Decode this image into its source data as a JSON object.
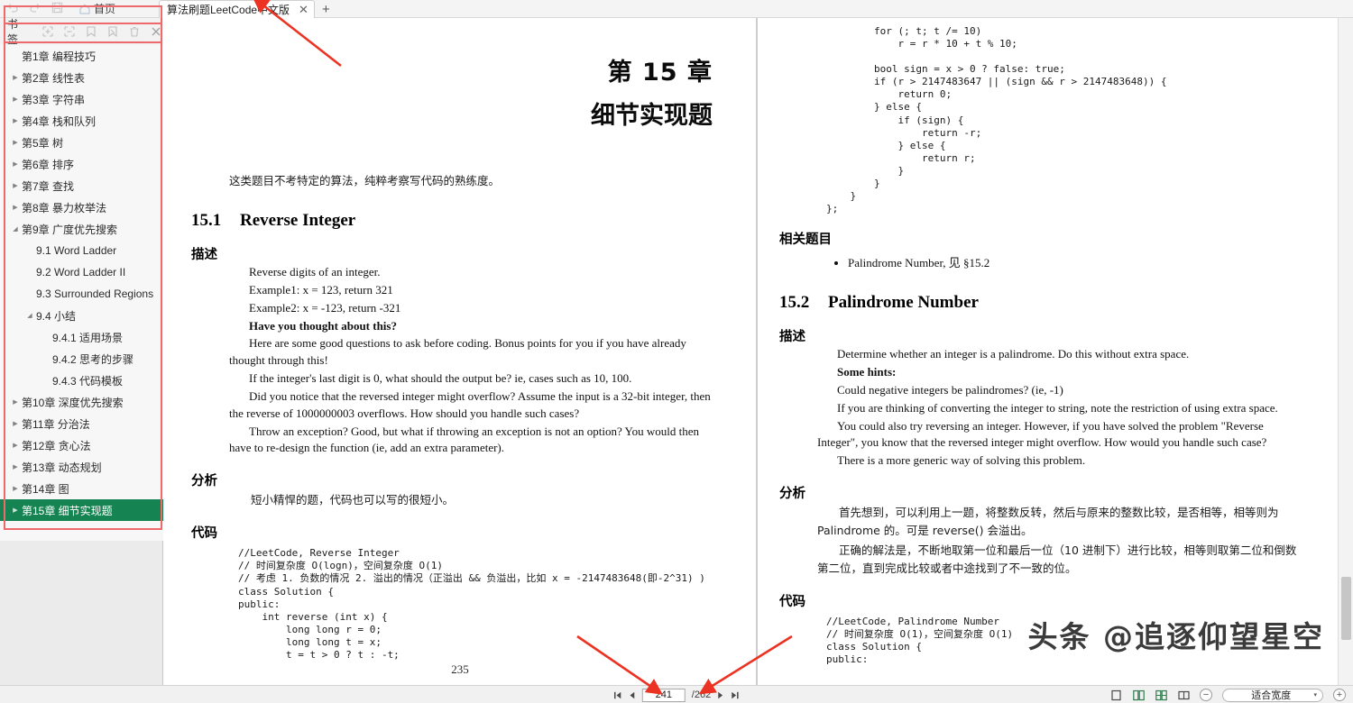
{
  "window": {
    "quick_access": [
      "undo-icon",
      "redo-icon",
      "save-icon"
    ],
    "home_label": "首页",
    "tab_title": "算法刷题LeetCode中文版",
    "tab_close": "✕",
    "new_tab": "+"
  },
  "sidebar": {
    "bookmarks_label": "书签",
    "tool_icons": [
      "expand-all-icon",
      "collapse-all-icon",
      "add-bookmark-icon",
      "edit-bookmark-icon",
      "delete-bookmark-icon",
      "close-panel-icon"
    ],
    "tree": [
      {
        "label": "第1章  编程技巧",
        "level": 0,
        "arrow": "",
        "selected": false
      },
      {
        "label": "第2章  线性表",
        "level": 0,
        "arrow": "▶",
        "selected": false
      },
      {
        "label": "第3章  字符串",
        "level": 0,
        "arrow": "▶",
        "selected": false
      },
      {
        "label": "第4章  栈和队列",
        "level": 0,
        "arrow": "▶",
        "selected": false
      },
      {
        "label": "第5章  树",
        "level": 0,
        "arrow": "▶",
        "selected": false
      },
      {
        "label": "第6章  排序",
        "level": 0,
        "arrow": "▶",
        "selected": false
      },
      {
        "label": "第7章  查找",
        "level": 0,
        "arrow": "▶",
        "selected": false
      },
      {
        "label": "第8章  暴力枚举法",
        "level": 0,
        "arrow": "▶",
        "selected": false
      },
      {
        "label": "第9章  广度优先搜索",
        "level": 0,
        "arrow": "◢",
        "selected": false
      },
      {
        "label": "9.1 Word Ladder",
        "level": 1,
        "arrow": "",
        "selected": false
      },
      {
        "label": "9.2 Word Ladder II",
        "level": 1,
        "arrow": "",
        "selected": false
      },
      {
        "label": "9.3 Surrounded Regions",
        "level": 1,
        "arrow": "",
        "selected": false
      },
      {
        "label": "9.4 小结",
        "level": 1,
        "arrow": "◢",
        "selected": false
      },
      {
        "label": "9.4.1 适用场景",
        "level": 2,
        "arrow": "",
        "selected": false
      },
      {
        "label": "9.4.2 思考的步骤",
        "level": 2,
        "arrow": "",
        "selected": false
      },
      {
        "label": "9.4.3 代码模板",
        "level": 2,
        "arrow": "",
        "selected": false
      },
      {
        "label": "第10章  深度优先搜索",
        "level": 0,
        "arrow": "▶",
        "selected": false
      },
      {
        "label": "第11章  分治法",
        "level": 0,
        "arrow": "▶",
        "selected": false
      },
      {
        "label": "第12章  贪心法",
        "level": 0,
        "arrow": "▶",
        "selected": false
      },
      {
        "label": "第13章  动态规划",
        "level": 0,
        "arrow": "▶",
        "selected": false
      },
      {
        "label": "第14章  图",
        "level": 0,
        "arrow": "▶",
        "selected": false
      },
      {
        "label": "第15章  细节实现题",
        "level": 0,
        "arrow": "▶",
        "selected": true
      }
    ]
  },
  "left_page": {
    "chapter_line1": "第 15 章",
    "chapter_line2": "细节实现题",
    "lead": "这类题目不考特定的算法，纯粹考察写代码的熟练度。",
    "section_num": "15.1",
    "section_title": "Reverse Integer",
    "desc_heading": "描述",
    "desc_lines": [
      "Reverse digits of an integer.",
      "Example1: x = 123, return 321",
      "Example2: x = -123, return -321"
    ],
    "desc_bold": "Have you thought about this?",
    "desc_paras": [
      "Here are some good questions to ask before coding. Bonus points for you if you have already thought through this!",
      "If the integer's last digit is 0, what should the output be? ie, cases such as 10, 100.",
      "Did you notice that the reversed integer might overflow? Assume the input is a 32-bit integer, then the reverse of 1000000003 overflows. How should you handle such cases?",
      "Throw an exception? Good, but what if throwing an exception is not an option? You would then have to re-design the function (ie, add an extra parameter)."
    ],
    "analysis_heading": "分析",
    "analysis_text": "短小精悍的题，代码也可以写的很短小。",
    "code_heading": "代码",
    "code": "//LeetCode, Reverse Integer\n// 时间复杂度 O(logn)，空间复杂度 O(1)\n// 考虑 1. 负数的情况 2. 溢出的情况（正溢出 && 负溢出，比如 x = -2147483648(即-2^31) )\nclass Solution {\npublic:\n    int reverse (int x) {\n        long long r = 0;\n        long long t = x;\n        t = t > 0 ? t : -t;",
    "page_number": "235"
  },
  "right_page": {
    "code_top": "        for (; t; t /= 10)\n            r = r * 10 + t % 10;\n\n        bool sign = x > 0 ? false: true;\n        if (r > 2147483647 || (sign && r > 2147483648)) {\n            return 0;\n        } else {\n            if (sign) {\n                return -r;\n            } else {\n                return r;\n            }\n        }\n    }\n};",
    "related_heading": "相关题目",
    "related_items": [
      "Palindrome Number, 见 §15.2"
    ],
    "section_num": "15.2",
    "section_title": "Palindrome Number",
    "desc_heading": "描述",
    "desc_line1": "Determine whether an integer is a palindrome. Do this without extra space.",
    "desc_bold": "Some hints:",
    "desc_paras": [
      "Could negative integers be palindromes? (ie, -1)",
      "If you are thinking of converting the integer to string, note the restriction of using extra space.",
      "You could also try reversing an integer. However, if you have solved the problem \"Reverse Integer\", you know that the reversed integer might overflow. How would you handle such case?",
      "There is a more generic way of solving this problem."
    ],
    "analysis_heading": "分析",
    "analysis_paras": [
      "首先想到，可以利用上一题，将整数反转，然后与原来的整数比较，是否相等，相等则为 Palindrome 的。可是 reverse() 会溢出。",
      "正确的解法是，不断地取第一位和最后一位（10 进制下）进行比较，相等则取第二位和倒数第二位，直到完成比较或者中途找到了不一致的位。"
    ],
    "code_heading": "代码",
    "code": "//LeetCode, Palindrome Number\n// 时间复杂度 O(1)，空间复杂度 O(1)\nclass Solution {\npublic:"
  },
  "watermark": "头条 @追逐仰望星空",
  "bottom_bar": {
    "first_page_icon": "first-page-icon",
    "prev_page_icon": "prev-page-icon",
    "current_page": "241",
    "total_pages": "/262",
    "next_page_icon": "next-page-icon",
    "last_page_icon": "last-page-icon",
    "view_mode_icons": [
      "single-page-icon",
      "continuous-scroll-icon",
      "two-page-icon",
      "two-page-scroll-icon"
    ],
    "zoom_out": "−",
    "zoom_level": "适合宽度",
    "zoom_caret": "▾",
    "zoom_in": "+"
  },
  "colors": {
    "selection_green": "#158452",
    "annotation_red": "#ec3323",
    "highlight_pink": "#ee6a6a"
  }
}
